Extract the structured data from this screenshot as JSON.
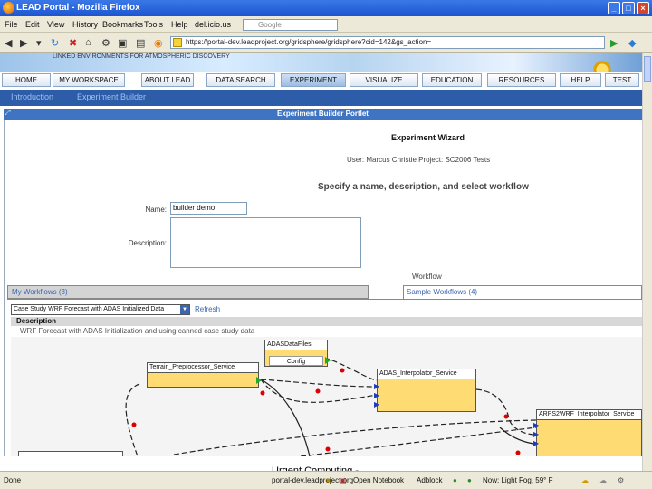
{
  "window": {
    "title": "LEAD Portal - Mozilla Firefox",
    "controls": [
      "_",
      "□",
      "×"
    ]
  },
  "menu": [
    "File",
    "Edit",
    "View",
    "History",
    "Bookmarks",
    "Tools",
    "Help",
    "del.icio.us"
  ],
  "search": {
    "placeholder": "Google"
  },
  "url": "https://portal-dev.leadproject.org/gridsphere/gridsphere?cid=142&gs_action=",
  "banner": {
    "text": "LINKED ENVIRONMENTS FOR ATMOSPHERIC DISCOVERY"
  },
  "tabs": [
    "HOME",
    "MY WORKSPACE",
    "ABOUT LEAD",
    "DATA SEARCH",
    "EXPERIMENT",
    "VISUALIZE",
    "EDUCATION",
    "RESOURCES",
    "HELP",
    "TEST"
  ],
  "active_tab": "EXPERIMENT",
  "subnav": [
    "Introduction",
    "Experiment Builder"
  ],
  "portlet": {
    "title": "Experiment Builder Portlet",
    "wizard_title": "Experiment Wizard",
    "user_line": "User: Marcus Christie   Project: SC2006 Tests",
    "instruction": "Specify a name, description, and select workflow",
    "name_label": "Name:",
    "name_value": "builder demo",
    "description_label": "Description:",
    "workflow_label": "Workflow",
    "my_workflows": "My Workflows (3)",
    "sample_workflows": "Sample Workflows (4)",
    "selected_workflow": "Case Study WRF Forecast with ADAS Initialized Data",
    "refresh": "Refresh",
    "description_heading": "Description",
    "description_text": "WRF Forecast with ADAS Initialization and using canned case study data"
  },
  "workflow_nodes": [
    {
      "title": "ADASDataFiles",
      "body": "Config"
    },
    {
      "title": "Terrain_Preprocessor_Service",
      "body": ""
    },
    {
      "title": "ADAS_Interpolator_Service",
      "body": ""
    },
    {
      "title": "ARPS2WRF_Interpolator_Service",
      "body": ""
    }
  ],
  "status": {
    "left": "Done",
    "host": "portal-dev.leadproject.org",
    "notebook": "Open Notebook",
    "adblock": "Adblock",
    "weather": "Now: Light Fog, 59° F"
  },
  "footer_note": "Urgent Computing -"
}
